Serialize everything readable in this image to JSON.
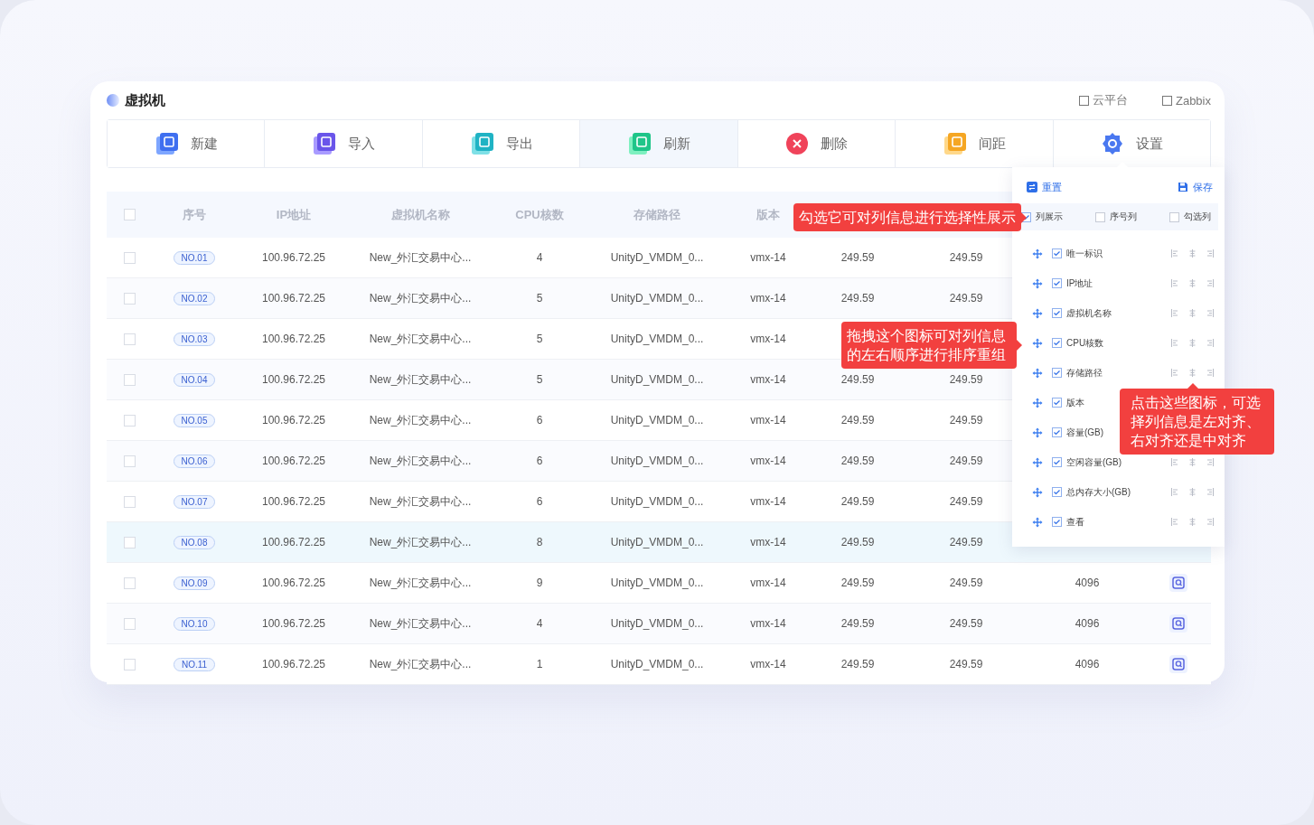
{
  "title": "虚拟机",
  "sources": [
    {
      "label": "云平台",
      "checked": false
    },
    {
      "label": "Zabbix",
      "checked": false
    }
  ],
  "toolbar": [
    {
      "label": "新建",
      "selected": false
    },
    {
      "label": "导入",
      "selected": false
    },
    {
      "label": "导出",
      "selected": false
    },
    {
      "label": "刷新",
      "selected": true
    },
    {
      "label": "删除",
      "selected": false
    },
    {
      "label": "间距",
      "selected": false
    },
    {
      "label": "设置",
      "selected": false
    }
  ],
  "table": {
    "header_checked": false,
    "columns": [
      "序号",
      "IP地址",
      "虚拟机名称",
      "CPU核数",
      "存储路径",
      "版本"
    ],
    "rows": [
      {
        "checked": false,
        "selected": false,
        "no": "NO.01",
        "ip": "100.96.72.25",
        "name": "New_外汇交易中心...",
        "cpu": "4",
        "path": "UnityD_VMDM_0...",
        "version": "vmx-14",
        "column_8": "249.59",
        "column_9": "249.59"
      },
      {
        "checked": false,
        "selected": false,
        "no": "NO.02",
        "ip": "100.96.72.25",
        "name": "New_外汇交易中心...",
        "cpu": "5",
        "path": "UnityD_VMDM_0...",
        "version": "vmx-14",
        "column_8": "249.59",
        "column_9": "249.59"
      },
      {
        "checked": false,
        "selected": false,
        "no": "NO.03",
        "ip": "100.96.72.25",
        "name": "New_外汇交易中心...",
        "cpu": "5",
        "path": "UnityD_VMDM_0...",
        "version": "vmx-14"
      },
      {
        "checked": false,
        "selected": false,
        "no": "NO.04",
        "ip": "100.96.72.25",
        "name": "New_外汇交易中心...",
        "cpu": "5",
        "path": "UnityD_VMDM_0...",
        "version": "vmx-14",
        "column_8": "249.59",
        "column_9": "249.59"
      },
      {
        "checked": false,
        "selected": false,
        "no": "NO.05",
        "ip": "100.96.72.25",
        "name": "New_外汇交易中心...",
        "cpu": "6",
        "path": "UnityD_VMDM_0...",
        "version": "vmx-14",
        "column_8": "249.59",
        "column_9": "249.59"
      },
      {
        "checked": false,
        "selected": false,
        "no": "NO.06",
        "ip": "100.96.72.25",
        "name": "New_外汇交易中心...",
        "cpu": "6",
        "path": "UnityD_VMDM_0...",
        "version": "vmx-14",
        "column_8": "249.59",
        "column_9": "249.59"
      },
      {
        "checked": false,
        "selected": false,
        "no": "NO.07",
        "ip": "100.96.72.25",
        "name": "New_外汇交易中心...",
        "cpu": "6",
        "path": "UnityD_VMDM_0...",
        "version": "vmx-14",
        "column_8": "249.59",
        "column_9": "249.59"
      },
      {
        "checked": false,
        "selected": true,
        "no": "NO.08",
        "ip": "100.96.72.25",
        "name": "New_外汇交易中心...",
        "cpu": "8",
        "path": "UnityD_VMDM_0...",
        "version": "vmx-14",
        "column_8": "249.59",
        "column_9": "249.59"
      },
      {
        "checked": false,
        "selected": false,
        "no": "NO.09",
        "ip": "100.96.72.25",
        "name": "New_外汇交易中心...",
        "cpu": "9",
        "path": "UnityD_VMDM_0...",
        "version": "vmx-14",
        "column_8": "249.59",
        "column_9": "249.59",
        "column_10": "4096",
        "view": true
      },
      {
        "checked": false,
        "selected": false,
        "no": "NO.10",
        "ip": "100.96.72.25",
        "name": "New_外汇交易中心...",
        "cpu": "4",
        "path": "UnityD_VMDM_0...",
        "version": "vmx-14",
        "column_8": "249.59",
        "column_9": "249.59",
        "column_10": "4096",
        "view": true
      },
      {
        "checked": false,
        "selected": false,
        "no": "NO.11",
        "ip": "100.96.72.25",
        "name": "New_外汇交易中心...",
        "cpu": "1",
        "path": "UnityD_VMDM_0...",
        "version": "vmx-14",
        "column_8": "249.59",
        "column_9": "249.59",
        "column_10": "4096",
        "view": true
      }
    ]
  },
  "column_panel": {
    "reset": "重置",
    "save": "保存",
    "options": [
      {
        "label": "列展示",
        "checked": true
      },
      {
        "label": "序号列",
        "checked": false
      },
      {
        "label": "勾选列",
        "checked": false
      }
    ],
    "columns": [
      {
        "label": "唯一标识",
        "checked": true,
        "align_buttons": true
      },
      {
        "label": "IP地址",
        "checked": true,
        "align_buttons": true
      },
      {
        "label": "虚拟机名称",
        "checked": true,
        "align_buttons": true
      },
      {
        "label": "CPU核数",
        "checked": true,
        "align_buttons": true
      },
      {
        "label": "存储路径",
        "checked": true,
        "align_buttons": true
      },
      {
        "label": "版本",
        "checked": true,
        "align_buttons": false
      },
      {
        "label": "容量(GB)",
        "checked": true,
        "align_buttons": false
      },
      {
        "label": "空闲容量(GB)",
        "checked": true,
        "align_buttons": true
      },
      {
        "label": "总内存大小(GB)",
        "checked": true,
        "align_buttons": true
      },
      {
        "label": "查看",
        "checked": true,
        "align_buttons": true
      }
    ]
  },
  "callouts": [
    {
      "kind": "right",
      "text": "勾选它可对列信息进行选择性展示"
    },
    {
      "kind": "right",
      "text": "拖拽这个图标可对列信息的左右顺序进行排序重组"
    },
    {
      "kind": "up",
      "text": "点击这些图标，可选择列信息是左对齐、右对齐还是中对齐"
    }
  ]
}
